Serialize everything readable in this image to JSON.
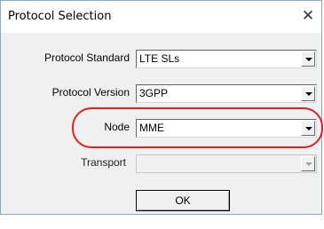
{
  "window": {
    "title": "Protocol Selection",
    "close_icon": "close-icon"
  },
  "fields": [
    {
      "label": "Protocol Standard",
      "value": "LTE SLs",
      "enabled": true
    },
    {
      "label": "Protocol Version",
      "value": "3GPP",
      "enabled": true
    },
    {
      "label": "Node",
      "value": "MME",
      "enabled": true,
      "highlighted": true
    },
    {
      "label": "Transport",
      "value": "",
      "enabled": false
    }
  ],
  "ok_label": "OK",
  "colors": {
    "highlight": "#e02020",
    "dialog_border": "#8aa8cc",
    "client_background": "#f0f0f0"
  }
}
